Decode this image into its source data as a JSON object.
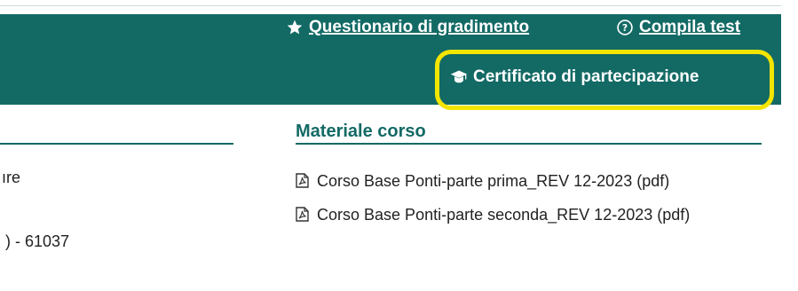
{
  "header": {
    "links": [
      {
        "label": "Questionario di gradimento",
        "icon": "star-icon"
      },
      {
        "label": "Compila test",
        "icon": "question-circle-icon"
      },
      {
        "label": "Certificato di partecipazione",
        "icon": "graduation-cap-icon"
      }
    ]
  },
  "left_column": {
    "texts": [
      "ıre",
      ") - 61037"
    ]
  },
  "materials": {
    "heading": "Materiale corso",
    "files": [
      {
        "name": "Corso Base Ponti-parte prima_REV 12-2023 (pdf)",
        "icon": "pdf-file-icon"
      },
      {
        "name": "Corso Base Ponti-parte seconda_REV 12-2023 (pdf)",
        "icon": "pdf-file-icon"
      }
    ]
  },
  "colors": {
    "brand": "#136a65",
    "highlight": "#f4e500",
    "text": "#222222"
  }
}
